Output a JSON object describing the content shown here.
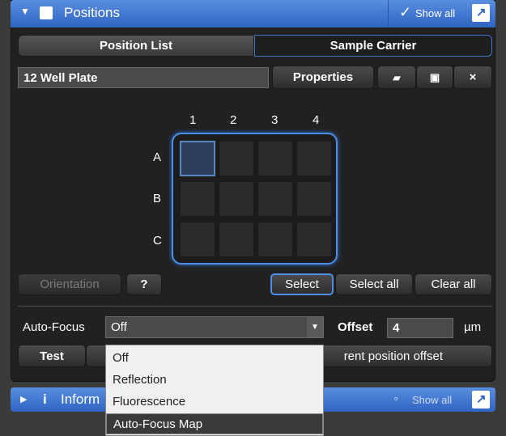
{
  "title_bar": {
    "title": "Positions",
    "show_all": "Show all",
    "check": "✓"
  },
  "tabs": [
    {
      "label": "Position List"
    },
    {
      "label": "Sample Carrier"
    }
  ],
  "carrier": {
    "name": "12 Well Plate",
    "properties": "Properties"
  },
  "file_icons": {
    "open": "▰",
    "save": "▣",
    "close": "×"
  },
  "plate": {
    "columns": [
      "1",
      "2",
      "3",
      "4"
    ],
    "rows": [
      "A",
      "B",
      "C"
    ]
  },
  "buttons": {
    "orientation": "Orientation",
    "help": "?",
    "select": "Select",
    "select_all": "Select all",
    "clear_all": "Clear all"
  },
  "autofocus": {
    "label": "Auto-Focus",
    "value": "Off",
    "offset_label": "Offset",
    "offset_value": "4",
    "unit": "µm"
  },
  "bottom": {
    "test": "Test",
    "current_offset": "rent position offset"
  },
  "dropdown": {
    "options": [
      "Off",
      "Reflection",
      "Fluorescence",
      "Auto-Focus Map"
    ]
  },
  "info_bar": {
    "icon": "i",
    "title": "Inform",
    "show_all": "Show all",
    "square": "▫"
  }
}
